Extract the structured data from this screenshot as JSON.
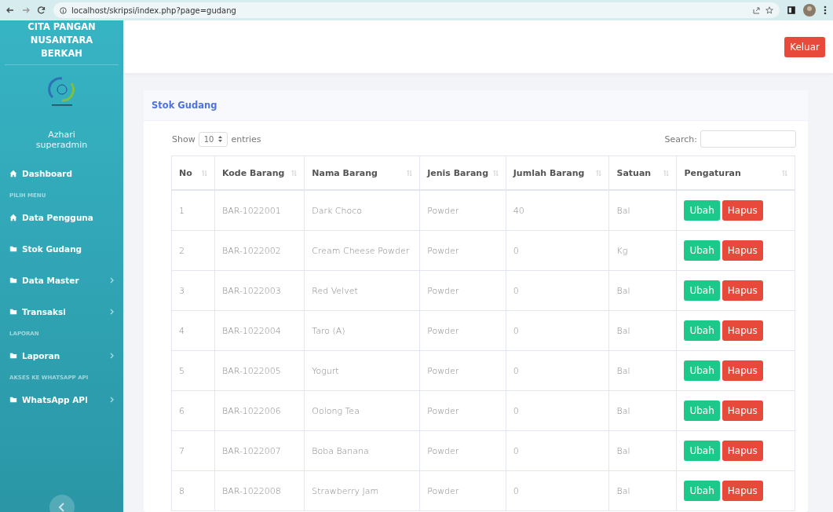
{
  "browser": {
    "url": "localhost/skripsi/index.php?page=gudang"
  },
  "sidebar": {
    "brand": "CITA PANGAN NUSANTARA BERKAH",
    "user_name": "Azhari",
    "user_role": "superadmin",
    "items": [
      {
        "kind": "home",
        "label": "Dashboard",
        "has_submenu": false
      },
      {
        "kind": "heading",
        "label": "PILIH MENU"
      },
      {
        "kind": "home",
        "label": "Data Pengguna",
        "has_submenu": false
      },
      {
        "kind": "folder",
        "label": "Stok Gudang",
        "has_submenu": false
      },
      {
        "kind": "folder",
        "label": "Data Master",
        "has_submenu": true
      },
      {
        "kind": "folder",
        "label": "Transaksi",
        "has_submenu": true
      },
      {
        "kind": "heading",
        "label": "LAPORAN"
      },
      {
        "kind": "folder",
        "label": "Laporan",
        "has_submenu": true
      },
      {
        "kind": "heading",
        "label": "AKSES KE WHATSAPP API"
      },
      {
        "kind": "folder",
        "label": "WhatsApp API",
        "has_submenu": true
      }
    ]
  },
  "topbar": {
    "logout_button": "Keluar"
  },
  "card": {
    "title": "Stok Gudang",
    "show_label": "Show",
    "page_length": "10",
    "entries_label": "entries",
    "search_label": "Search:",
    "table": {
      "columns": [
        "No",
        "Kode Barang",
        "Nama Barang",
        "Jenis Barang",
        "Jumlah Barang",
        "Satuan",
        "Pengaturan"
      ],
      "rows": [
        {
          "cells": [
            "1",
            "BAR-1022001",
            "Dark Choco",
            "Powder",
            "40",
            "Bal"
          ],
          "edit": "Ubah",
          "delete": "Hapus"
        },
        {
          "cells": [
            "2",
            "BAR-1022002",
            "Cream Cheese Powder",
            "Powder",
            "0",
            "Kg"
          ],
          "edit": "Ubah",
          "delete": "Hapus"
        },
        {
          "cells": [
            "3",
            "BAR-1022003",
            "Red Velvet",
            "Powder",
            "0",
            "Bal"
          ],
          "edit": "Ubah",
          "delete": "Hapus"
        },
        {
          "cells": [
            "4",
            "BAR-1022004",
            "Taro (A)",
            "Powder",
            "0",
            "Bal"
          ],
          "edit": "Ubah",
          "delete": "Hapus"
        },
        {
          "cells": [
            "5",
            "BAR-1022005",
            "Yogurt",
            "Powder",
            "0",
            "Bal"
          ],
          "edit": "Ubah",
          "delete": "Hapus"
        },
        {
          "cells": [
            "6",
            "BAR-1022006",
            "Oolong Tea",
            "Powder",
            "0",
            "Bal"
          ],
          "edit": "Ubah",
          "delete": "Hapus"
        },
        {
          "cells": [
            "7",
            "BAR-1022007",
            "Boba Banana",
            "Powder",
            "0",
            "Bal"
          ],
          "edit": "Ubah",
          "delete": "Hapus"
        },
        {
          "cells": [
            "8",
            "BAR-1022008",
            "Strawberry Jam",
            "Powder",
            "0",
            "Bal"
          ],
          "edit": "Ubah",
          "delete": "Hapus"
        }
      ]
    }
  }
}
